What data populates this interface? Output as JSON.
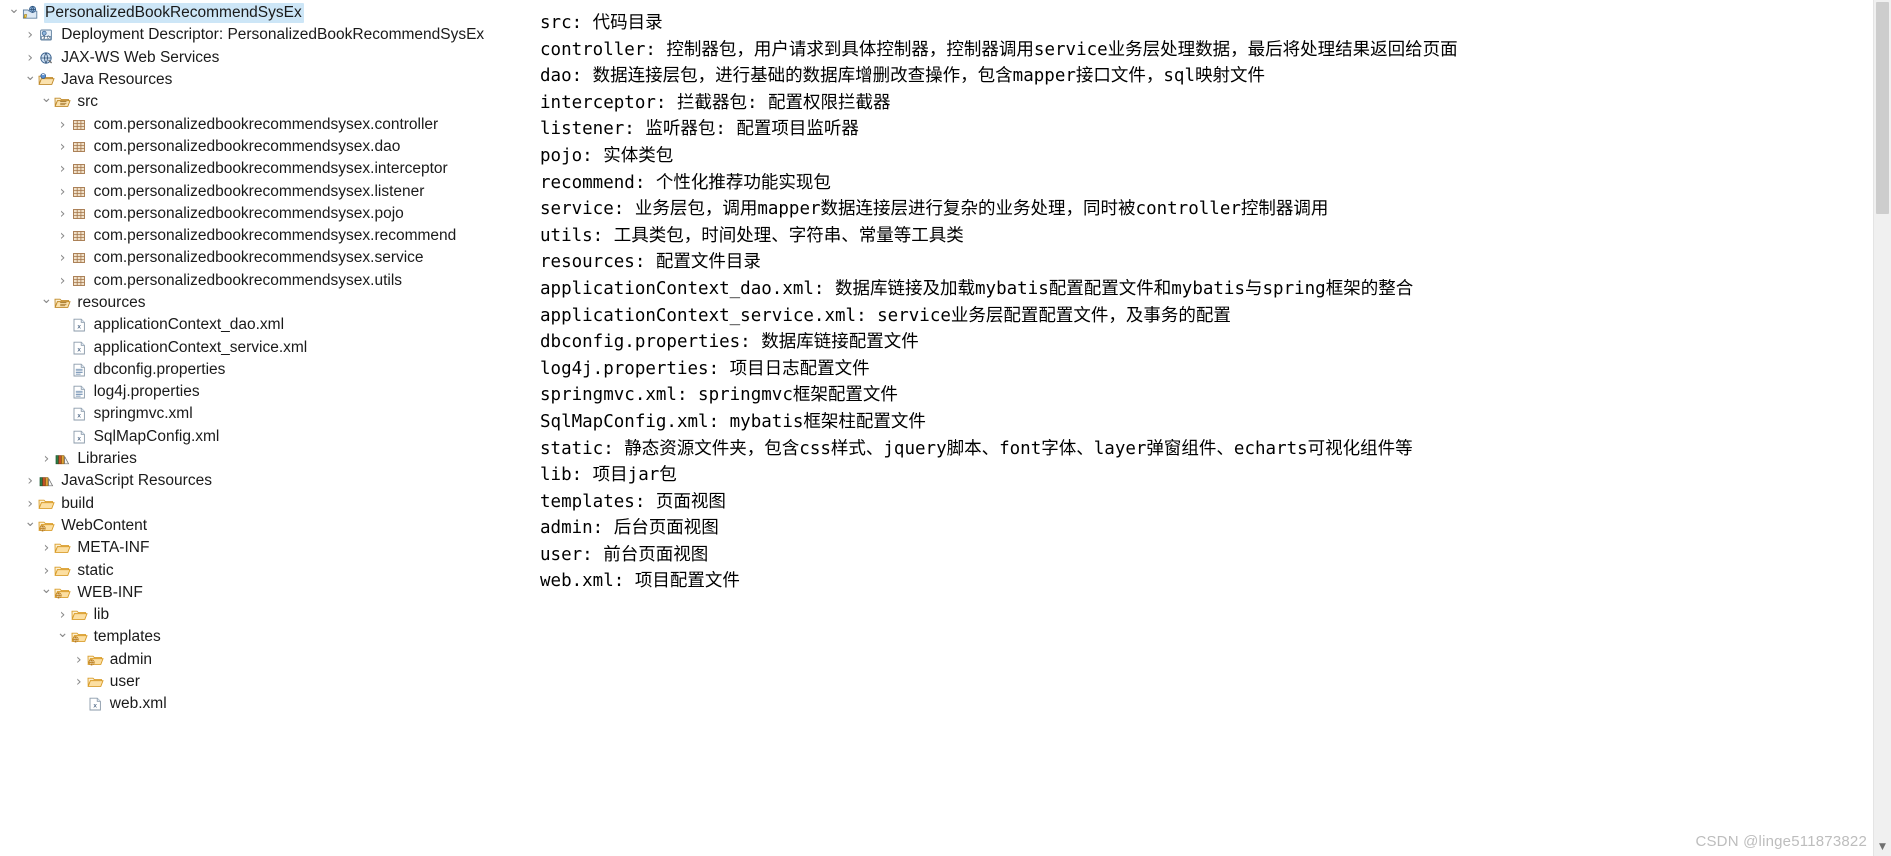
{
  "explorer": {
    "name": "project-explorer",
    "tree": [
      {
        "label": "PersonalizedBookRecommendSysEx",
        "indent": 0,
        "twisty": "expanded",
        "icon": "web-project-icon",
        "selected": true
      },
      {
        "label": "Deployment Descriptor: PersonalizedBookRecommendSysEx",
        "indent": 1,
        "twisty": "collapsed",
        "icon": "deployment-descriptor-icon",
        "selected": false
      },
      {
        "label": "JAX-WS Web Services",
        "indent": 1,
        "twisty": "collapsed",
        "icon": "webservice-icon",
        "selected": false
      },
      {
        "label": "Java Resources",
        "indent": 1,
        "twisty": "expanded",
        "icon": "java-resources-icon",
        "selected": false
      },
      {
        "label": "src",
        "indent": 2,
        "twisty": "expanded",
        "icon": "source-folder-icon",
        "selected": false
      },
      {
        "label": "com.personalizedbookrecommendsysex.controller",
        "indent": 3,
        "twisty": "collapsed",
        "icon": "package-icon",
        "selected": false
      },
      {
        "label": "com.personalizedbookrecommendsysex.dao",
        "indent": 3,
        "twisty": "collapsed",
        "icon": "package-icon",
        "selected": false
      },
      {
        "label": "com.personalizedbookrecommendsysex.interceptor",
        "indent": 3,
        "twisty": "collapsed",
        "icon": "package-icon",
        "selected": false
      },
      {
        "label": "com.personalizedbookrecommendsysex.listener",
        "indent": 3,
        "twisty": "collapsed",
        "icon": "package-icon",
        "selected": false
      },
      {
        "label": "com.personalizedbookrecommendsysex.pojo",
        "indent": 3,
        "twisty": "collapsed",
        "icon": "package-icon",
        "selected": false
      },
      {
        "label": "com.personalizedbookrecommendsysex.recommend",
        "indent": 3,
        "twisty": "collapsed",
        "icon": "package-icon",
        "selected": false
      },
      {
        "label": "com.personalizedbookrecommendsysex.service",
        "indent": 3,
        "twisty": "collapsed",
        "icon": "package-icon",
        "selected": false
      },
      {
        "label": "com.personalizedbookrecommendsysex.utils",
        "indent": 3,
        "twisty": "collapsed",
        "icon": "package-icon",
        "selected": false
      },
      {
        "label": "resources",
        "indent": 2,
        "twisty": "expanded",
        "icon": "source-folder-icon",
        "selected": false
      },
      {
        "label": "applicationContext_dao.xml",
        "indent": 3,
        "twisty": "none",
        "icon": "xml-file-icon",
        "selected": false
      },
      {
        "label": "applicationContext_service.xml",
        "indent": 3,
        "twisty": "none",
        "icon": "xml-file-icon",
        "selected": false
      },
      {
        "label": "dbconfig.properties",
        "indent": 3,
        "twisty": "none",
        "icon": "properties-file-icon",
        "selected": false
      },
      {
        "label": "log4j.properties",
        "indent": 3,
        "twisty": "none",
        "icon": "properties-file-icon",
        "selected": false
      },
      {
        "label": "springmvc.xml",
        "indent": 3,
        "twisty": "none",
        "icon": "xml-file-icon",
        "selected": false
      },
      {
        "label": "SqlMapConfig.xml",
        "indent": 3,
        "twisty": "none",
        "icon": "xml-file-icon",
        "selected": false
      },
      {
        "label": "Libraries",
        "indent": 2,
        "twisty": "collapsed",
        "icon": "libraries-icon",
        "selected": false
      },
      {
        "label": "JavaScript Resources",
        "indent": 1,
        "twisty": "collapsed",
        "icon": "libraries-icon",
        "selected": false
      },
      {
        "label": "build",
        "indent": 1,
        "twisty": "collapsed",
        "icon": "folder-icon",
        "selected": false
      },
      {
        "label": "WebContent",
        "indent": 1,
        "twisty": "expanded",
        "icon": "web-folder-icon",
        "selected": false
      },
      {
        "label": "META-INF",
        "indent": 2,
        "twisty": "collapsed",
        "icon": "folder-icon",
        "selected": false
      },
      {
        "label": "static",
        "indent": 2,
        "twisty": "collapsed",
        "icon": "folder-icon",
        "selected": false
      },
      {
        "label": "WEB-INF",
        "indent": 2,
        "twisty": "expanded",
        "icon": "web-folder-icon",
        "selected": false
      },
      {
        "label": "lib",
        "indent": 3,
        "twisty": "collapsed",
        "icon": "folder-icon",
        "selected": false
      },
      {
        "label": "templates",
        "indent": 3,
        "twisty": "expanded",
        "icon": "web-folder-icon",
        "selected": false
      },
      {
        "label": "admin",
        "indent": 4,
        "twisty": "collapsed",
        "icon": "web-folder-icon",
        "selected": false
      },
      {
        "label": "user",
        "indent": 4,
        "twisty": "collapsed",
        "icon": "folder-icon",
        "selected": false
      },
      {
        "label": "web.xml",
        "indent": 4,
        "twisty": "none",
        "icon": "xml-file-icon",
        "selected": false
      }
    ]
  },
  "document": {
    "lines": [
      "src: 代码目录",
      "controller: 控制器包，用户请求到具体控制器，控制器调用service业务层处理数据，最后将处理结果返回给页面",
      "dao: 数据连接层包，进行基础的数据库增删改查操作，包含mapper接口文件，sql映射文件",
      "interceptor: 拦截器包: 配置权限拦截器",
      "listener: 监听器包: 配置项目监听器",
      "pojo: 实体类包",
      "recommend: 个性化推荐功能实现包",
      "service: 业务层包，调用mapper数据连接层进行复杂的业务处理，同时被controller控制器调用",
      "utils: 工具类包，时间处理、字符串、常量等工具类",
      "resources: 配置文件目录",
      "applicationContext_dao.xml: 数据库链接及加载mybatis配置配置文件和mybatis与spring框架的整合",
      "applicationContext_service.xml: service业务层配置配置文件，及事务的配置",
      "dbconfig.properties: 数据库链接配置文件",
      "log4j.properties: 项目日志配置文件",
      "springmvc.xml: springmvc框架配置文件",
      "SqlMapConfig.xml: mybatis框架柱配置文件",
      "static: 静态资源文件夹，包含css样式、jquery脚本、font字体、layer弹窗组件、echarts可视化组件等",
      "lib: 项目jar包",
      "templates: 页面视图",
      "admin: 后台页面视图",
      "user: 前台页面视图",
      "web.xml: 项目配置文件"
    ]
  },
  "scrollbar": {
    "up_arrow": "▲",
    "down_arrow": "▼"
  },
  "watermark": {
    "text": "CSDN @linge511873822"
  },
  "colors": {
    "selection": "#cde6f7",
    "folder": "#e8a33d",
    "package": "#b08a5a",
    "text": "#1a1a1a",
    "watermark": "#bdbdbd"
  }
}
